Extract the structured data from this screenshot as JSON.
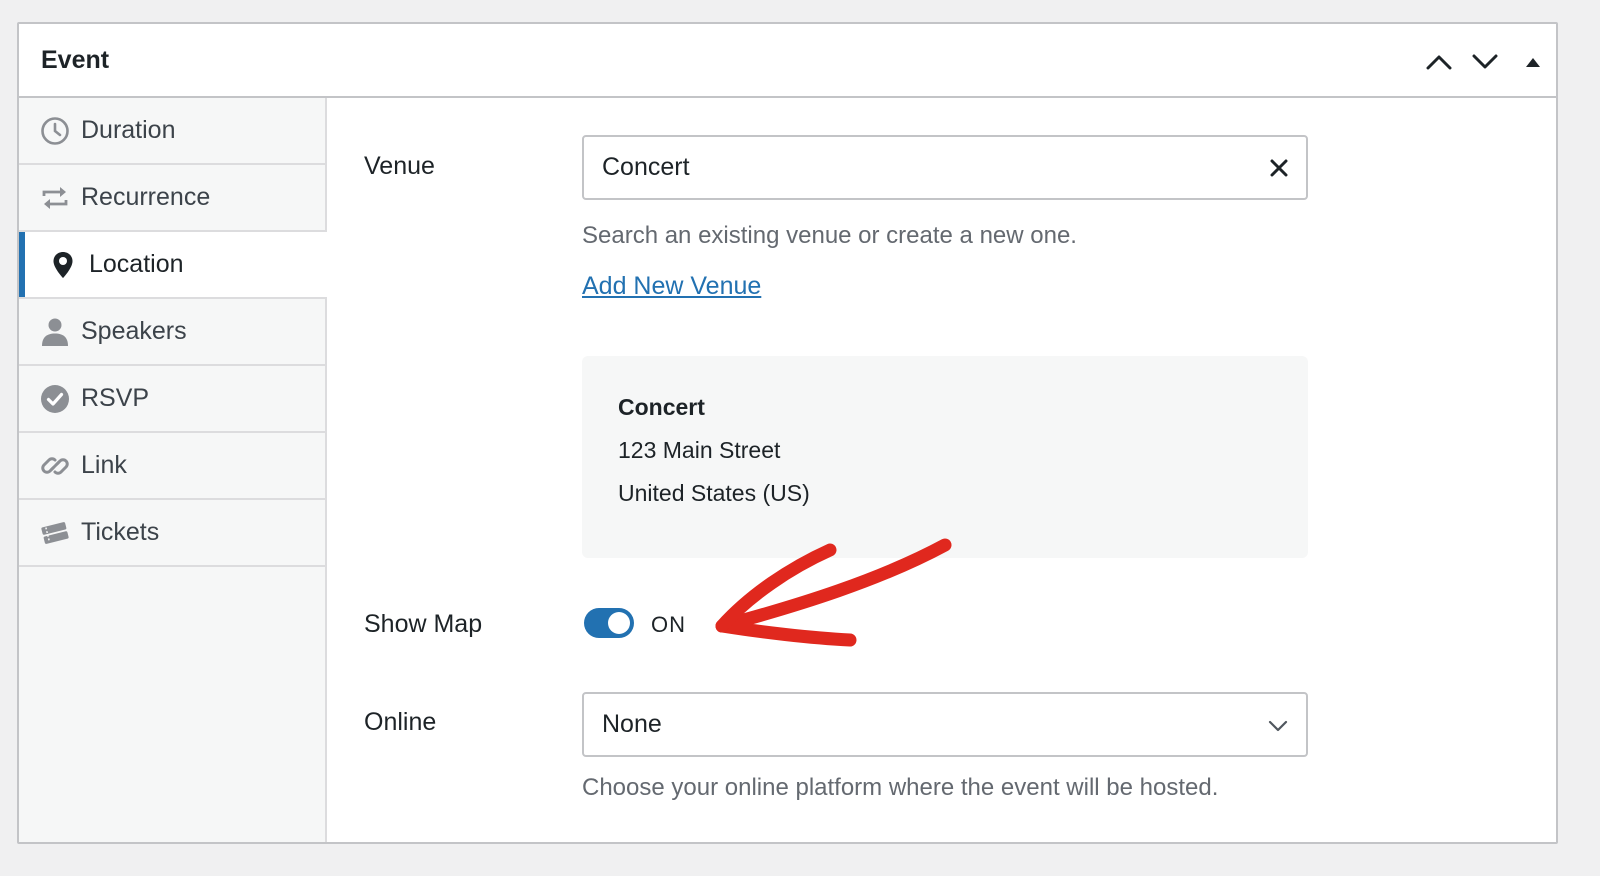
{
  "panel": {
    "title": "Event"
  },
  "sidebar": {
    "items": [
      {
        "label": "Duration",
        "icon": "clock-icon"
      },
      {
        "label": "Recurrence",
        "icon": "repeat-icon"
      },
      {
        "label": "Location",
        "icon": "location-pin-icon",
        "active": true
      },
      {
        "label": "Speakers",
        "icon": "person-icon"
      },
      {
        "label": "RSVP",
        "icon": "check-circle-icon"
      },
      {
        "label": "Link",
        "icon": "link-icon"
      },
      {
        "label": "Tickets",
        "icon": "tickets-icon"
      }
    ]
  },
  "venue": {
    "label": "Venue",
    "value": "Concert",
    "help": "Search an existing venue or create a new one.",
    "add_link": "Add New Venue",
    "card": {
      "name": "Concert",
      "street": "123 Main Street",
      "country": "United States (US)"
    }
  },
  "show_map": {
    "label": "Show Map",
    "state": "ON",
    "enabled": true
  },
  "online": {
    "label": "Online",
    "value": "None",
    "help": "Choose your online platform where the event will be hosted."
  },
  "colors": {
    "accent": "#2271b1",
    "annotation_arrow": "#e0281e"
  }
}
